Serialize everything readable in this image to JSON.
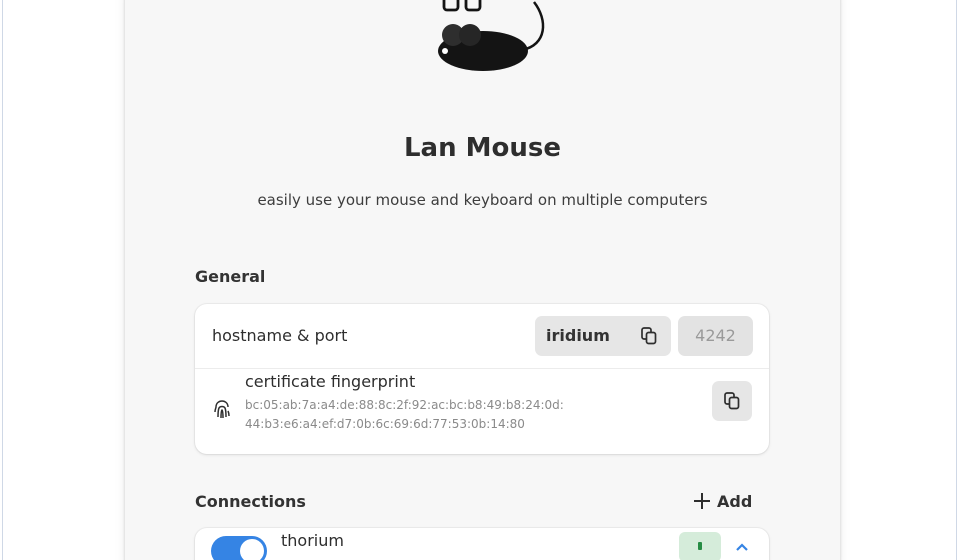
{
  "app": {
    "title": "Lan Mouse",
    "subtitle": "easily use your mouse and keyboard on multiple computers",
    "logo_icon": "mouse-logo-icon"
  },
  "general": {
    "heading": "General",
    "hostname_row": {
      "label": "hostname & port",
      "hostname": "iridium",
      "port_placeholder": "4242",
      "copy_icon": "copy-icon"
    },
    "fingerprint_row": {
      "label": "certificate fingerprint",
      "value_line1": "bc:05:ab:7a:a4:de:88:8c:2f:92:ac:bc:b8:49:b8:24:0d:",
      "value_line2": "44:b3:e6:a4:ef:d7:0b:6c:69:6d:77:53:0b:14:80",
      "icon": "fingerprint-icon",
      "copy_icon": "copy-icon"
    }
  },
  "connections": {
    "heading": "Connections",
    "add_label": "Add",
    "add_icon": "plus-icon",
    "items": [
      {
        "name": "thorium",
        "enabled": true,
        "status_color": "#268c44"
      }
    ]
  },
  "colors": {
    "accent": "#3584e4",
    "window_bg": "#f7f7f7",
    "card_bg": "#ffffff"
  }
}
